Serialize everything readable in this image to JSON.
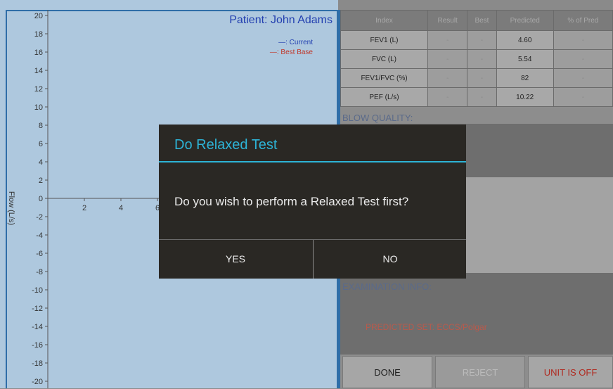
{
  "chart": {
    "patient_title": "Patient: John Adams",
    "legend_current": "—: Current",
    "legend_best": "—: Best Base",
    "ylabel": "Flow (L/s)",
    "y_ticks": [
      "20",
      "18",
      "16",
      "14",
      "12",
      "10",
      "8",
      "6",
      "4",
      "2",
      "0",
      "-2",
      "-4",
      "-6",
      "-8",
      "-10",
      "-12",
      "-14",
      "-16",
      "-18",
      "-20"
    ],
    "x_ticks": [
      "2",
      "4",
      "6"
    ]
  },
  "results_table": {
    "headers": [
      "Index",
      "Result",
      "Best",
      "Predicted",
      "% of Pred"
    ],
    "rows": [
      [
        "FEV1 (L)",
        "-",
        "-",
        "4.60",
        "-"
      ],
      [
        "FVC (L)",
        "-",
        "-",
        "5.54",
        "-"
      ],
      [
        "FEV1/FVC (%)",
        "-",
        "-",
        "82",
        "-"
      ],
      [
        "PEF (L/s)",
        "-",
        "-",
        "10.22",
        "-"
      ]
    ]
  },
  "sections": {
    "blow_quality": "BLOW QUALITY:",
    "exam_info": "EXAMINATION INFO:",
    "predicted_set": "PREDICTED SET: ECCS/Polgar"
  },
  "buttons": {
    "done": "DONE",
    "reject": "REJECT",
    "unit": "UNIT IS OFF"
  },
  "dialog": {
    "title": "Do Relaxed Test",
    "message": "Do you wish to perform a Relaxed Test first?",
    "yes": "YES",
    "no": "NO"
  },
  "colors": {
    "accent": "#2db3d6",
    "current": "#2340b0",
    "best": "#c0392b",
    "unit_off": "#b02a20"
  }
}
